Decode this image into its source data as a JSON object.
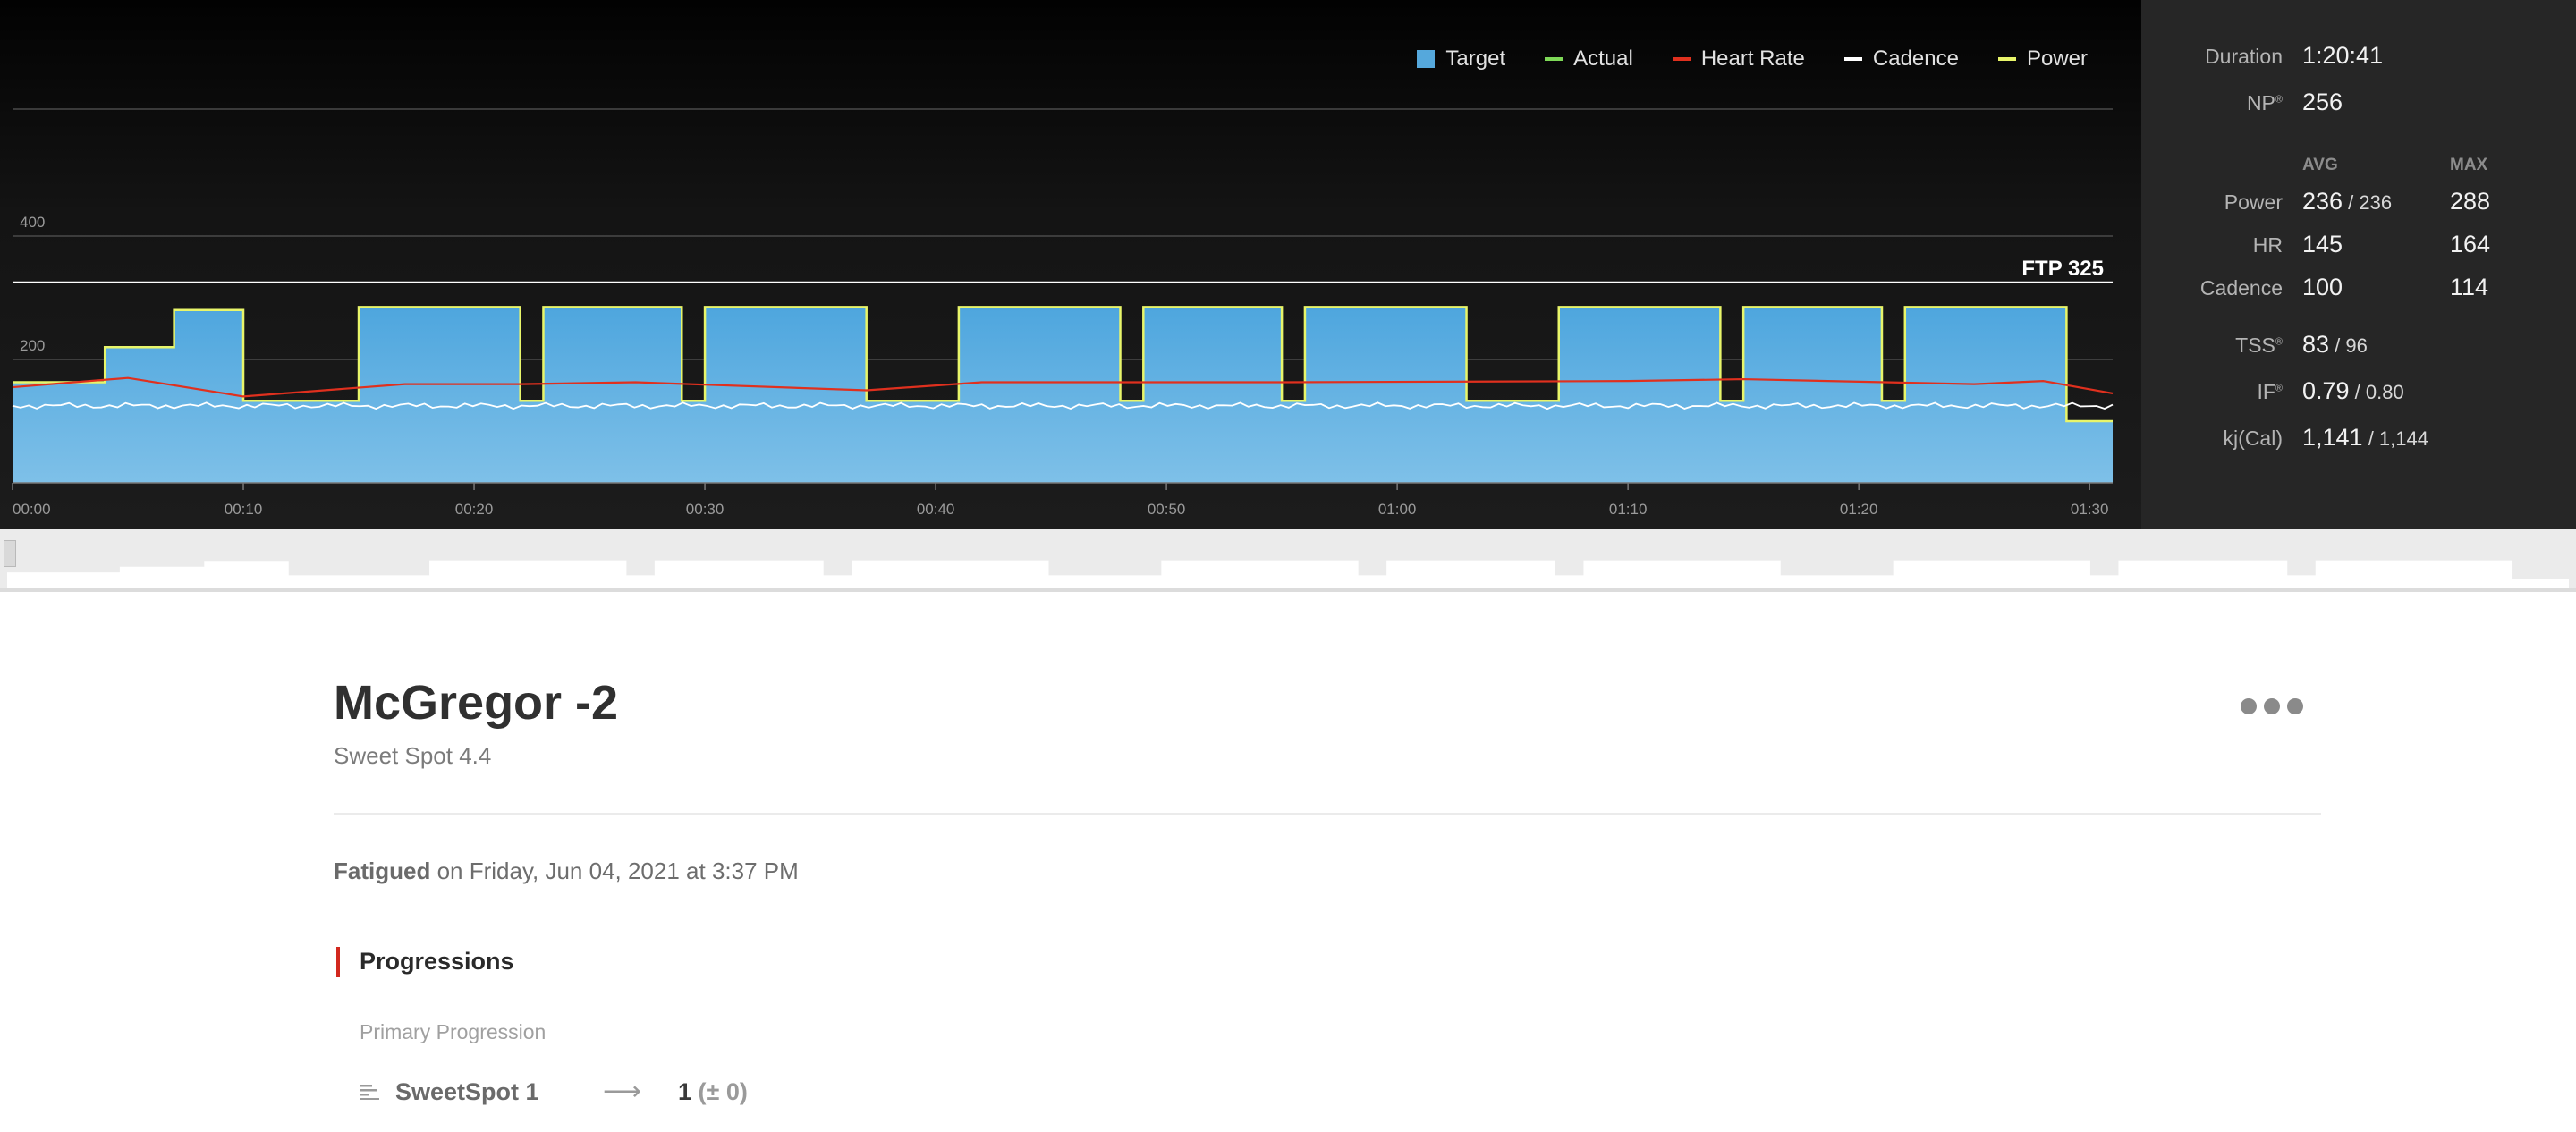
{
  "legend": [
    {
      "label": "Target",
      "color": "#55a8dc",
      "shape": "box"
    },
    {
      "label": "Actual",
      "color": "#7ed957",
      "shape": "line"
    },
    {
      "label": "Heart Rate",
      "color": "#e0301e",
      "shape": "line"
    },
    {
      "label": "Cadence",
      "color": "#ffffff",
      "shape": "line"
    },
    {
      "label": "Power",
      "color": "#e8f56a",
      "shape": "line"
    }
  ],
  "chart_data": {
    "type": "area",
    "x_ticks": [
      "00:00",
      "00:10",
      "00:20",
      "00:30",
      "00:40",
      "00:50",
      "01:00",
      "01:10",
      "01:20",
      "01:30"
    ],
    "x_range_minutes": [
      0,
      91
    ],
    "y_ticks": [
      200,
      400
    ],
    "y_range_watts": [
      0,
      605
    ],
    "ftp_line": {
      "label": "FTP 325",
      "value": 325
    },
    "target_power_segments": [
      {
        "start_min": 0,
        "end_min": 4,
        "watts": 163
      },
      {
        "start_min": 4,
        "end_min": 7,
        "watts": 220
      },
      {
        "start_min": 7,
        "end_min": 10,
        "watts": 280
      },
      {
        "start_min": 10,
        "end_min": 15,
        "watts": 133
      },
      {
        "start_min": 15,
        "end_min": 22,
        "watts": 285
      },
      {
        "start_min": 22,
        "end_min": 23,
        "watts": 133
      },
      {
        "start_min": 23,
        "end_min": 29,
        "watts": 285
      },
      {
        "start_min": 29,
        "end_min": 30,
        "watts": 133
      },
      {
        "start_min": 30,
        "end_min": 37,
        "watts": 285
      },
      {
        "start_min": 37,
        "end_min": 41,
        "watts": 133
      },
      {
        "start_min": 41,
        "end_min": 48,
        "watts": 285
      },
      {
        "start_min": 48,
        "end_min": 49,
        "watts": 133
      },
      {
        "start_min": 49,
        "end_min": 55,
        "watts": 285
      },
      {
        "start_min": 55,
        "end_min": 56,
        "watts": 133
      },
      {
        "start_min": 56,
        "end_min": 63,
        "watts": 285
      },
      {
        "start_min": 63,
        "end_min": 67,
        "watts": 133
      },
      {
        "start_min": 67,
        "end_min": 74,
        "watts": 285
      },
      {
        "start_min": 74,
        "end_min": 75,
        "watts": 133
      },
      {
        "start_min": 75,
        "end_min": 81,
        "watts": 285
      },
      {
        "start_min": 81,
        "end_min": 82,
        "watts": 133
      },
      {
        "start_min": 82,
        "end_min": 85,
        "watts": 285
      },
      {
        "start_min": 85,
        "end_min": 89,
        "watts": 285
      },
      {
        "start_min": 89,
        "end_min": 91,
        "watts": 100
      }
    ],
    "heart_rate_trend": [
      {
        "min": 0,
        "bpm_scaled": 155
      },
      {
        "min": 5,
        "bpm_scaled": 170
      },
      {
        "min": 10,
        "bpm_scaled": 140
      },
      {
        "min": 17,
        "bpm_scaled": 160
      },
      {
        "min": 22,
        "bpm_scaled": 160
      },
      {
        "min": 27,
        "bpm_scaled": 163
      },
      {
        "min": 37,
        "bpm_scaled": 150
      },
      {
        "min": 42,
        "bpm_scaled": 163
      },
      {
        "min": 55,
        "bpm_scaled": 163
      },
      {
        "min": 70,
        "bpm_scaled": 165
      },
      {
        "min": 75,
        "bpm_scaled": 168
      },
      {
        "min": 85,
        "bpm_scaled": 160
      },
      {
        "min": 88,
        "bpm_scaled": 165
      },
      {
        "min": 91,
        "bpm_scaled": 145
      }
    ],
    "cadence_level_scaled": 100
  },
  "stats": {
    "duration_label": "Duration",
    "duration": "1:20:41",
    "np_label": "NP",
    "np": "256",
    "avg_head": "AVG",
    "max_head": "MAX",
    "power_label": "Power",
    "power_avg": "236",
    "power_target": "236",
    "power_max": "288",
    "hr_label": "HR",
    "hr_avg": "145",
    "hr_max": "164",
    "cadence_label": "Cadence",
    "cadence_avg": "100",
    "cadence_max": "114",
    "tss_label": "TSS",
    "tss": "83",
    "tss_target": "96",
    "if_label": "IF",
    "if": "0.79",
    "if_target": "0.80",
    "kj_label": "kj(Cal)",
    "kj": "1,141",
    "kj_target": "1,144",
    "registered_mark": "®"
  },
  "workout": {
    "title": "McGregor -2",
    "subtitle": "Sweet Spot 4.4",
    "survey_word": "Fatigued",
    "survey_rest": " on Friday, Jun 04, 2021 at 3:37 PM",
    "progressions_title": "Progressions",
    "primary_label": "Primary Progression",
    "progression_name": "SweetSpot 1",
    "progression_arrow": "⟶",
    "progression_level": "1",
    "progression_change": "(± 0)"
  }
}
